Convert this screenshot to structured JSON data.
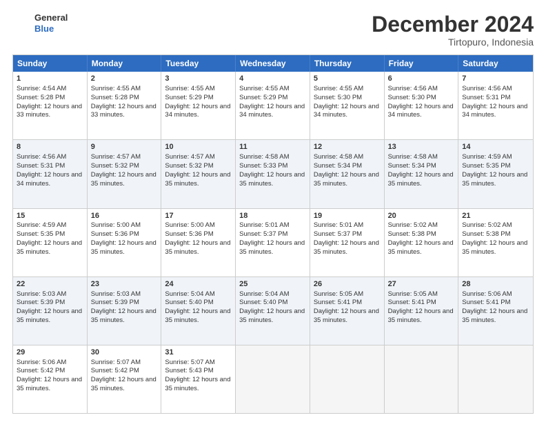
{
  "logo": {
    "line1": "General",
    "line2": "Blue"
  },
  "title": "December 2024",
  "subtitle": "Tirtopuro, Indonesia",
  "headers": [
    "Sunday",
    "Monday",
    "Tuesday",
    "Wednesday",
    "Thursday",
    "Friday",
    "Saturday"
  ],
  "rows": [
    [
      {
        "day": "1",
        "rise": "4:54 AM",
        "set": "5:28 PM",
        "daylight": "12 hours and 33 minutes."
      },
      {
        "day": "2",
        "rise": "4:55 AM",
        "set": "5:28 PM",
        "daylight": "12 hours and 33 minutes."
      },
      {
        "day": "3",
        "rise": "4:55 AM",
        "set": "5:29 PM",
        "daylight": "12 hours and 34 minutes."
      },
      {
        "day": "4",
        "rise": "4:55 AM",
        "set": "5:29 PM",
        "daylight": "12 hours and 34 minutes."
      },
      {
        "day": "5",
        "rise": "4:55 AM",
        "set": "5:30 PM",
        "daylight": "12 hours and 34 minutes."
      },
      {
        "day": "6",
        "rise": "4:56 AM",
        "set": "5:30 PM",
        "daylight": "12 hours and 34 minutes."
      },
      {
        "day": "7",
        "rise": "4:56 AM",
        "set": "5:31 PM",
        "daylight": "12 hours and 34 minutes."
      }
    ],
    [
      {
        "day": "8",
        "rise": "4:56 AM",
        "set": "5:31 PM",
        "daylight": "12 hours and 34 minutes."
      },
      {
        "day": "9",
        "rise": "4:57 AM",
        "set": "5:32 PM",
        "daylight": "12 hours and 35 minutes."
      },
      {
        "day": "10",
        "rise": "4:57 AM",
        "set": "5:32 PM",
        "daylight": "12 hours and 35 minutes."
      },
      {
        "day": "11",
        "rise": "4:58 AM",
        "set": "5:33 PM",
        "daylight": "12 hours and 35 minutes."
      },
      {
        "day": "12",
        "rise": "4:58 AM",
        "set": "5:34 PM",
        "daylight": "12 hours and 35 minutes."
      },
      {
        "day": "13",
        "rise": "4:58 AM",
        "set": "5:34 PM",
        "daylight": "12 hours and 35 minutes."
      },
      {
        "day": "14",
        "rise": "4:59 AM",
        "set": "5:35 PM",
        "daylight": "12 hours and 35 minutes."
      }
    ],
    [
      {
        "day": "15",
        "rise": "4:59 AM",
        "set": "5:35 PM",
        "daylight": "12 hours and 35 minutes."
      },
      {
        "day": "16",
        "rise": "5:00 AM",
        "set": "5:36 PM",
        "daylight": "12 hours and 35 minutes."
      },
      {
        "day": "17",
        "rise": "5:00 AM",
        "set": "5:36 PM",
        "daylight": "12 hours and 35 minutes."
      },
      {
        "day": "18",
        "rise": "5:01 AM",
        "set": "5:37 PM",
        "daylight": "12 hours and 35 minutes."
      },
      {
        "day": "19",
        "rise": "5:01 AM",
        "set": "5:37 PM",
        "daylight": "12 hours and 35 minutes."
      },
      {
        "day": "20",
        "rise": "5:02 AM",
        "set": "5:38 PM",
        "daylight": "12 hours and 35 minutes."
      },
      {
        "day": "21",
        "rise": "5:02 AM",
        "set": "5:38 PM",
        "daylight": "12 hours and 35 minutes."
      }
    ],
    [
      {
        "day": "22",
        "rise": "5:03 AM",
        "set": "5:39 PM",
        "daylight": "12 hours and 35 minutes."
      },
      {
        "day": "23",
        "rise": "5:03 AM",
        "set": "5:39 PM",
        "daylight": "12 hours and 35 minutes."
      },
      {
        "day": "24",
        "rise": "5:04 AM",
        "set": "5:40 PM",
        "daylight": "12 hours and 35 minutes."
      },
      {
        "day": "25",
        "rise": "5:04 AM",
        "set": "5:40 PM",
        "daylight": "12 hours and 35 minutes."
      },
      {
        "day": "26",
        "rise": "5:05 AM",
        "set": "5:41 PM",
        "daylight": "12 hours and 35 minutes."
      },
      {
        "day": "27",
        "rise": "5:05 AM",
        "set": "5:41 PM",
        "daylight": "12 hours and 35 minutes."
      },
      {
        "day": "28",
        "rise": "5:06 AM",
        "set": "5:41 PM",
        "daylight": "12 hours and 35 minutes."
      }
    ],
    [
      {
        "day": "29",
        "rise": "5:06 AM",
        "set": "5:42 PM",
        "daylight": "12 hours and 35 minutes."
      },
      {
        "day": "30",
        "rise": "5:07 AM",
        "set": "5:42 PM",
        "daylight": "12 hours and 35 minutes."
      },
      {
        "day": "31",
        "rise": "5:07 AM",
        "set": "5:43 PM",
        "daylight": "12 hours and 35 minutes."
      },
      null,
      null,
      null,
      null
    ]
  ]
}
